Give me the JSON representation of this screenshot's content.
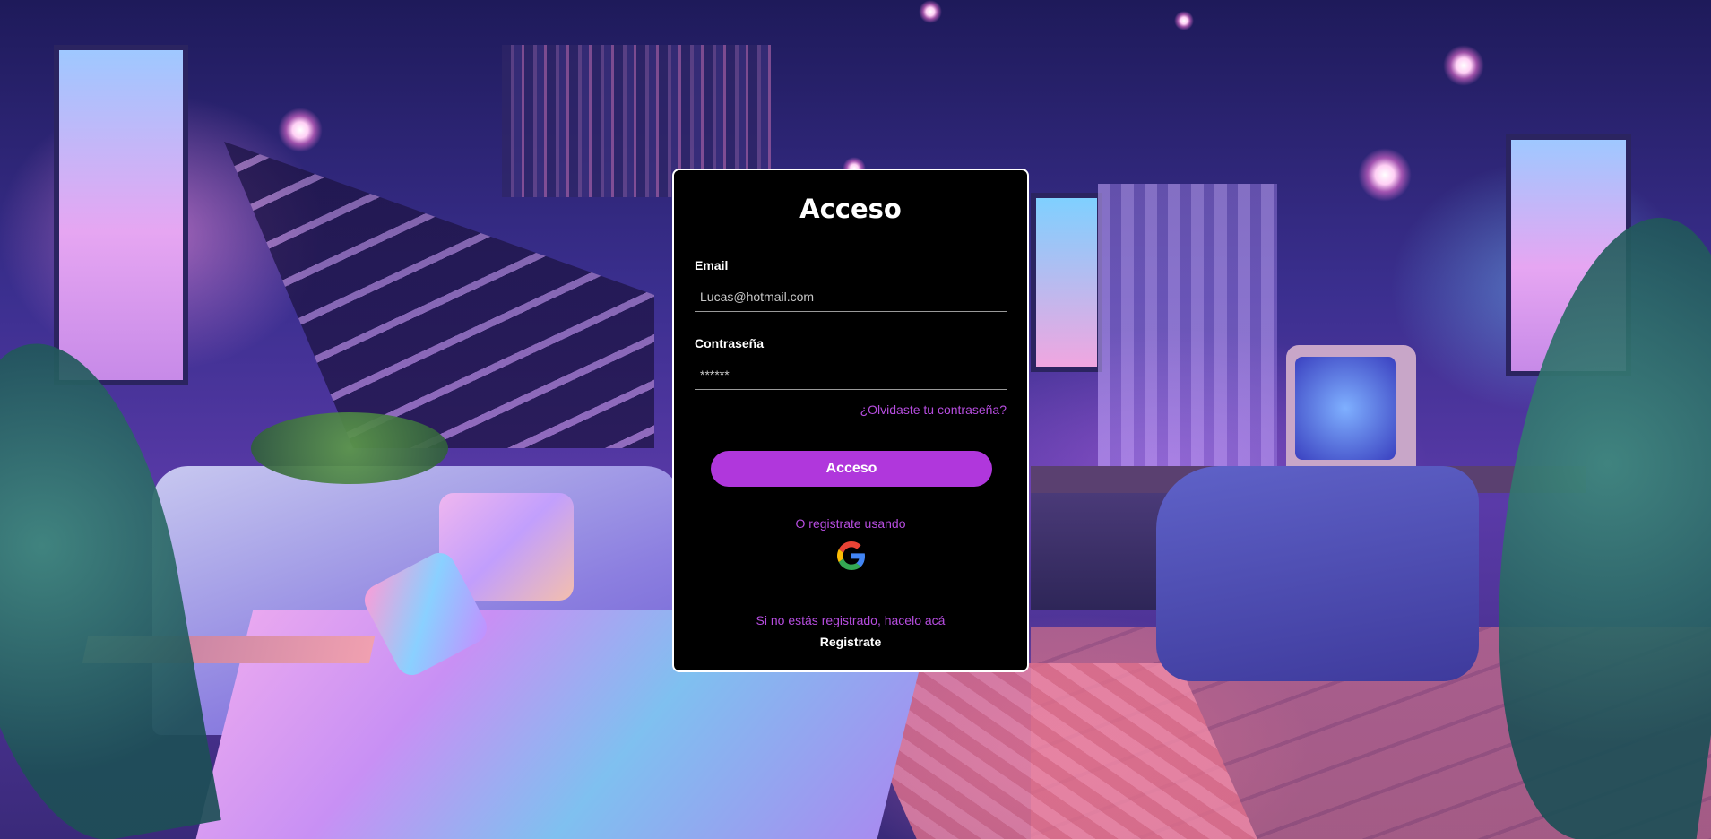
{
  "login": {
    "title": "Acceso",
    "email_label": "Email",
    "email_placeholder": "Lucas@hotmail.com",
    "password_label": "Contraseña",
    "password_placeholder": "******",
    "forgot_link": "¿Olvidaste tu contraseña?",
    "submit_label": "Acceso",
    "or_text": "O registrate usando",
    "google_icon": "google-icon",
    "no_account_text": "Si no estás registrado, hacelo acá",
    "register_link": "Registrate"
  },
  "colors": {
    "accent": "#b037dc",
    "link": "#b64ddf",
    "card_background": "#000000",
    "card_border": "#ffffff"
  }
}
